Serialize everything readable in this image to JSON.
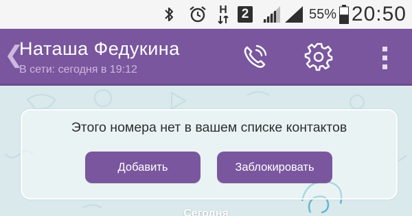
{
  "status_bar": {
    "battery_percent": "55%",
    "time": "20:50",
    "icons": [
      "bluetooth-icon",
      "alarm-icon",
      "h-plus-data-icon",
      "sim-2-icon",
      "signal-icon",
      "signal-icon",
      "battery-icon"
    ],
    "sim_label": "2",
    "data_label": "H",
    "battery_level": 0.55
  },
  "header": {
    "back_glyph": "❮",
    "contact_name": "Наташа Федукина",
    "last_seen": "В сети: сегодня в 19:12",
    "actions": [
      "call-icon",
      "settings-icon",
      "overflow-menu-icon"
    ]
  },
  "unknown_contact_card": {
    "message": "Этого номера нет в вашем списке контактов",
    "add_label": "Добавить",
    "block_label": "Заблокировать"
  },
  "chat": {
    "date_separator": "Сегодня"
  },
  "colors": {
    "brand": "#7a569e",
    "status_bar": "#f5f5f5",
    "chat_bg": "#d9e9ec"
  }
}
